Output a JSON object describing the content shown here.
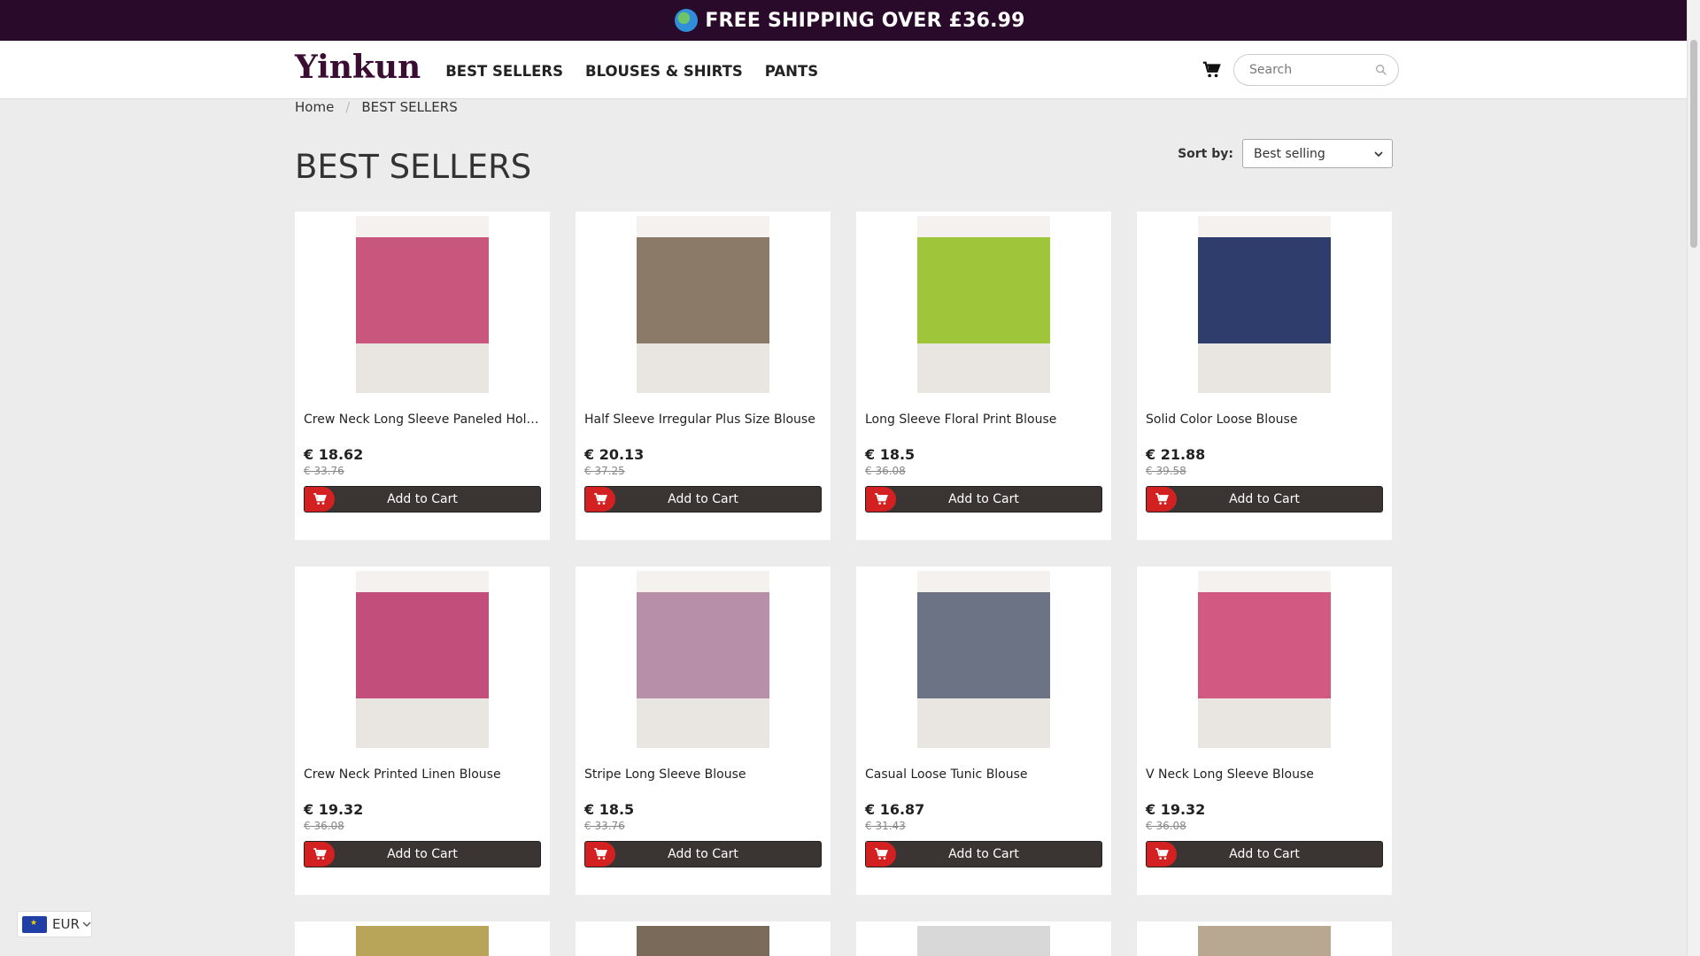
{
  "promo": {
    "text": "FREE SHIPPING OVER £36.99",
    "icon": "globe-icon"
  },
  "header": {
    "logo": "Yinkun",
    "nav": [
      "BEST SELLERS",
      "BLOUSES & SHIRTS",
      "PANTS"
    ],
    "search_placeholder": "Search"
  },
  "breadcrumb": {
    "home": "Home",
    "current": "BEST SELLERS"
  },
  "page_title": "BEST SELLERS",
  "sort": {
    "label": "Sort by:",
    "value": "Best selling"
  },
  "add_to_cart_label": "Add to Cart",
  "products": [
    {
      "name": "Crew Neck Long Sleeve Paneled Holiday...",
      "price": "€ 18.62",
      "old_price": "€ 33.76",
      "color": "#c9577d"
    },
    {
      "name": "Half Sleeve Irregular Plus Size Blouse",
      "price": "€ 20.13",
      "old_price": "€ 37.25",
      "color": "#8c7a68"
    },
    {
      "name": "Long Sleeve Floral Print Blouse",
      "price": "€ 18.5",
      "old_price": "€ 36.08",
      "color": "#9fc63a"
    },
    {
      "name": "Solid Color Loose Blouse",
      "price": "€ 21.88",
      "old_price": "€ 39.58",
      "color": "#2e3d6b"
    },
    {
      "name": "Crew Neck Printed Linen Blouse",
      "price": "€ 19.32",
      "old_price": "€ 36.08",
      "color": "#c24f7b"
    },
    {
      "name": "Stripe Long Sleeve Blouse",
      "price": "€ 18.5",
      "old_price": "€ 33.76",
      "color": "#b88fa8"
    },
    {
      "name": "Casual Loose Tunic Blouse",
      "price": "€ 16.87",
      "old_price": "€ 31.43",
      "color": "#6b7384"
    },
    {
      "name": "V Neck Long Sleeve Blouse",
      "price": "€ 19.32",
      "old_price": "€ 36.08",
      "color": "#d25a82"
    }
  ],
  "partial_colors": [
    "#b9a55a",
    "#7a6a5a",
    "#d8d8d8",
    "#b9a891"
  ],
  "currency": {
    "code": "EUR"
  }
}
